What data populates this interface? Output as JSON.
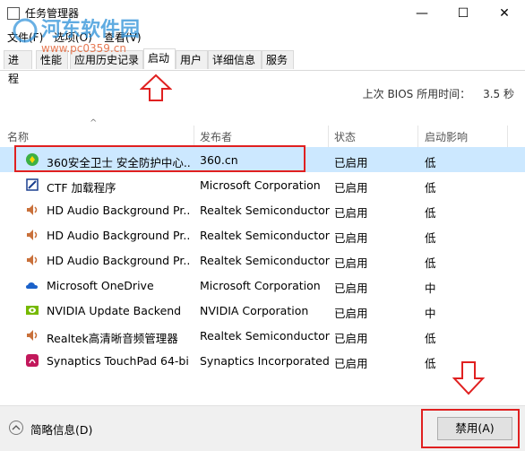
{
  "window": {
    "title": "任务管理器",
    "minimize": "—",
    "maximize": "☐",
    "close": "✕"
  },
  "menu": [
    "文件(F)",
    "选项(O)",
    "查看(V)"
  ],
  "tabs": [
    "进程",
    "性能",
    "应用历史记录",
    "启动",
    "用户",
    "详细信息",
    "服务"
  ],
  "active_tab": "启动",
  "bios": {
    "label": "上次 BIOS 所用时间：",
    "value": "3.5 秒"
  },
  "columns": {
    "name": "名称",
    "publisher": "发布者",
    "status": "状态",
    "impact": "启动影响"
  },
  "rows": [
    {
      "name": "360安全卫士 安全防护中心...",
      "publisher": "360.cn",
      "status": "已启用",
      "impact": "低",
      "icon": "360-icon"
    },
    {
      "name": "CTF 加载程序",
      "publisher": "Microsoft Corporation",
      "status": "已启用",
      "impact": "低",
      "icon": "ctf-icon"
    },
    {
      "name": "HD Audio Background Pr...",
      "publisher": "Realtek Semiconductor",
      "status": "已启用",
      "impact": "低",
      "icon": "speaker-icon"
    },
    {
      "name": "HD Audio Background Pr...",
      "publisher": "Realtek Semiconductor",
      "status": "已启用",
      "impact": "低",
      "icon": "speaker-icon"
    },
    {
      "name": "HD Audio Background Pr...",
      "publisher": "Realtek Semiconductor",
      "status": "已启用",
      "impact": "低",
      "icon": "speaker-icon"
    },
    {
      "name": "Microsoft OneDrive",
      "publisher": "Microsoft Corporation",
      "status": "已启用",
      "impact": "中",
      "icon": "cloud-icon"
    },
    {
      "name": "NVIDIA Update Backend",
      "publisher": "NVIDIA Corporation",
      "status": "已启用",
      "impact": "中",
      "icon": "nvidia-icon"
    },
    {
      "name": "Realtek高清晰音频管理器",
      "publisher": "Realtek Semiconductor",
      "status": "已启用",
      "impact": "低",
      "icon": "speaker-icon"
    },
    {
      "name": "Synaptics TouchPad 64-bi...",
      "publisher": "Synaptics Incorporated",
      "status": "已启用",
      "impact": "低",
      "icon": "synaptics-icon"
    }
  ],
  "footer": {
    "fewer_details": "简略信息(D)",
    "disable": "禁用(A)"
  },
  "watermark": {
    "name": "河东软件园",
    "url": "www.pc0359.cn"
  },
  "colors": {
    "selection": "#cce8ff",
    "annotation": "#e02020",
    "watermark": "#2a8fd8"
  }
}
